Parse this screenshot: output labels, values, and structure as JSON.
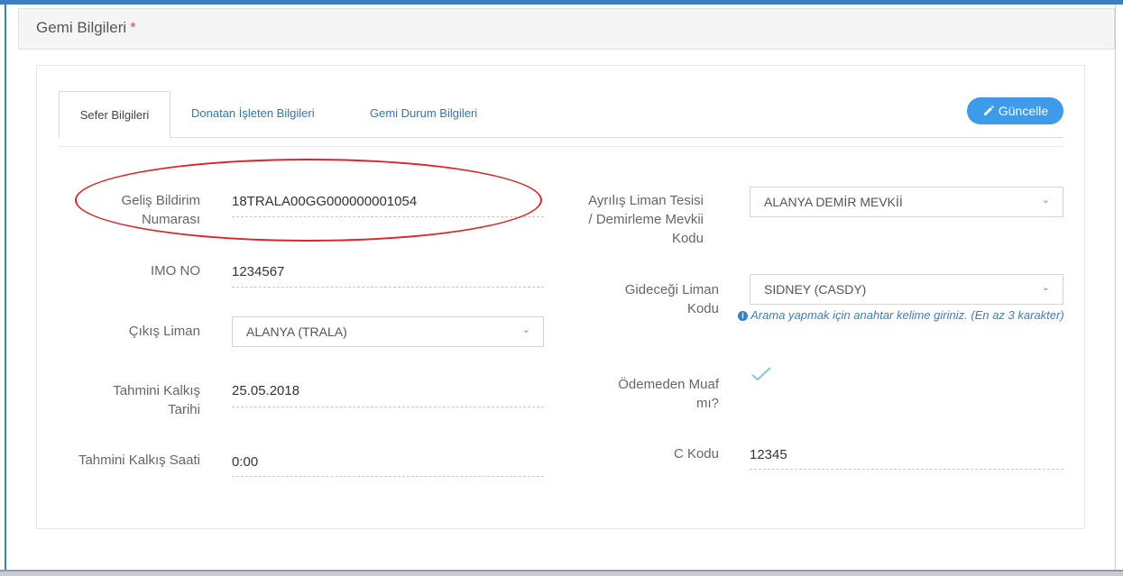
{
  "panel": {
    "title": "Gemi Bilgileri",
    "required_mark": "*"
  },
  "tabs": [
    {
      "label": "Sefer Bilgileri",
      "active": true
    },
    {
      "label": "Donatan İşleten Bilgileri",
      "active": false
    },
    {
      "label": "Gemi Durum Bilgileri",
      "active": false
    }
  ],
  "update_button": {
    "label": "Güncelle",
    "icon": "pencil-icon"
  },
  "left_fields": {
    "gelis_bildirim": {
      "label_line1": "Geliş Bildirim",
      "label_line2": "Numarası",
      "value": "18TRALA00GG000000001054"
    },
    "imo_no": {
      "label": "IMO NO",
      "value": "1234567"
    },
    "cikis_liman": {
      "label": "Çıkış Liman",
      "selected": "ALANYA (TRALA)"
    },
    "tahmini_kalkis_tarihi": {
      "label_line1": "Tahmini Kalkış",
      "label_line2": "Tarihi",
      "value": "25.05.2018"
    },
    "tahmini_kalkis_saati": {
      "label": "Tahmini Kalkış Saati",
      "value": "0:00"
    }
  },
  "right_fields": {
    "ayrilis_liman_tesisi": {
      "label_line1": "Ayrılış Liman Tesisi",
      "label_line2": "/ Demirleme Mevkii",
      "label_line3": "Kodu",
      "selected": "ALANYA DEMİR MEVKİİ"
    },
    "gidecegi_liman": {
      "label_line1": "Gideceği Liman",
      "label_line2": "Kodu",
      "selected": "SIDNEY (CASDY)",
      "help": "Arama yapmak için anahtar kelime giriniz. (En az 3 karakter)"
    },
    "odemeden_muaf": {
      "label_line1": "Ödemeden Muaf",
      "label_line2": "mı?",
      "checked": true
    },
    "c_kodu": {
      "label": "C Kodu",
      "value": "12345"
    }
  },
  "colors": {
    "accent": "#3a7fc1",
    "button": "#3d9be9",
    "highlight_oval": "#d8262b",
    "check": "#7fc8e3"
  }
}
